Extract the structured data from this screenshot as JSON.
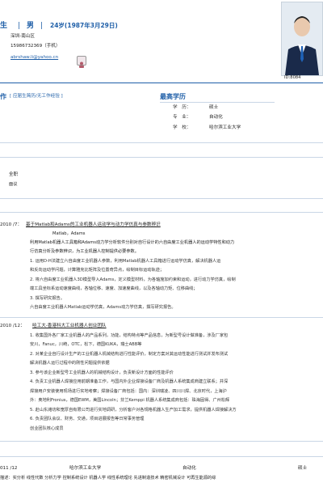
{
  "header": {
    "name_tail": "生",
    "sep1": "|",
    "gender": "男",
    "sep2": "|",
    "age_birth": "24岁(1987年3月29日)",
    "location": "深圳-南山区",
    "phone": "15986732369（手机）",
    "email": "abrshaw.li@yahoo.cn",
    "id_label": "ID:8084"
  },
  "intent": {
    "title_tail": "作",
    "subtitle": "[ 应届生简历/无工作经验 ]"
  },
  "education_summary": {
    "title": "最高学历",
    "rows": [
      {
        "label": "学　历：",
        "value": "硕士"
      },
      {
        "label": "专　业：",
        "value": "自动化"
      },
      {
        "label": "学　校：",
        "value": "哈尔滨工业大学"
      }
    ]
  },
  "job_intent": {
    "type": "全职",
    "location": "面议"
  },
  "project1": {
    "date": "2010 /7：",
    "title": "基于Matlab和Adams的工业机器人运动学与动力学仿真与参数辨识",
    "tools": "Matlab，Adams",
    "desc1": "利用Matlab机器人工具箱和Adams动力学分析软件分别对自行设计的六自由度工业机器人的运动学特性和动力",
    "desc2": "行仿真分析及参数辨识，为工业机器人控制提供必要参数。",
    "items": [
      "1. 运用D-H法建立六自由度工业机器人参数，利用Matlab机器人工具箱进行运动学仿真，解决机器人运",
      "和反向运动学问题，计算雅克比矩阵及位置奇异点，绘制目标运动轨迹；",
      "2. 将六自由度工业机器人3D模型导入Adams，定义模型材料，为各轴施加约束和运动，进行动力学仿真，绘制",
      "端工具坐标系运动速度曲线，各轴位移、速度、加速度曲线，以及各轴动力矩、位移曲线；",
      "3. 撰写研究报告。",
      "六自由度工业机器人Matlab运动学仿真，Adams动力学仿真，撰写研究报告。"
    ]
  },
  "project2": {
    "date": "2010 /12：",
    "title": "哈工大-香港科大工业机器人创业团队",
    "items": [
      "1. 收集国外各厂家工业机器人的产品系列，功能，结构特点等产品信息，为新型号设计做准备，涉及厂家包",
      "安川，Fanuc，川崎，OTC，松下，德国KUKA，瑞士ABB等",
      "2. 对某企业自行设计生产的工业机器人机械结构进行性能评价，制定方案对其运动性能进行测试并发布测试",
      "解决机器人运行过程中的刚性问题提供依据",
      "3. 参与该企业新型号工业机器人的机械结构设计，负责新设计方面的性能评价",
      "4. 负责工业机器人焊接应用前期准备工作，与国内外企业焊接设备厂商及机器人系统集成商建立联系；并深",
      "焊接用户安装使用现场进行实地考察；焊接设备厂商包括：国内：深圳瑞凌、四川川焊、北京时代，上海沪",
      "外：奥地利Fronius，德国EWM，美国Lincoln；芬兰Kemppi 机器人系统集成商包括：珠海固得、广州松辉",
      "5. 赴山东潍坊和宽厚自有限公司进行实地调研，分析客户对各规格机器人生产加工需求，提供机器人焊接解决方",
      "6. 负责团队会议、财务、交通，项目进展报告等日常事务管理",
      "创业团队核心成员"
    ]
  },
  "education_row": {
    "date": "011 /12",
    "school": "哈尔滨工业大学",
    "major": "自动化",
    "degree": "硕士"
  },
  "skills": "描述：实分析 线性代数 分析力学 控制系统设计 机器人学 线性系统理论 先进制造技术 精密机械设计 可再生能源的综"
}
